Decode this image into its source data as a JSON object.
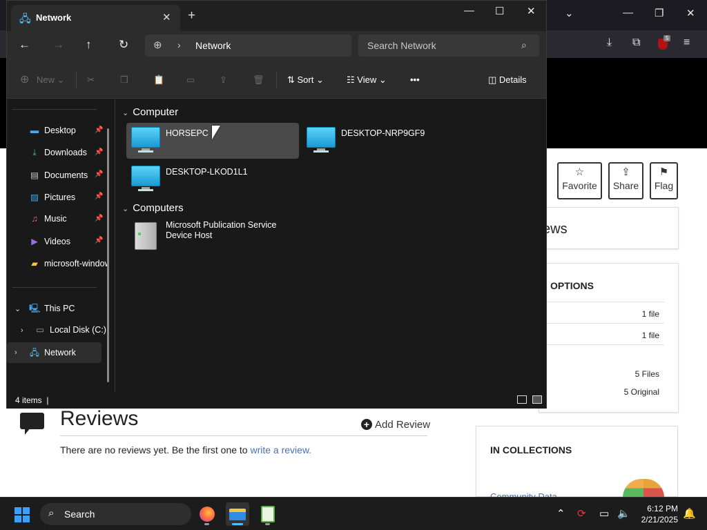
{
  "browser": {
    "window_controls": {
      "chevron": "⌄",
      "minimize": "—",
      "restore": "❐",
      "close": "✕"
    },
    "toolbar_icons": [
      "download-icon",
      "extensions-icon",
      "ublock-icon",
      "menu-icon"
    ],
    "ublock_badge": "5",
    "actions": {
      "favorite": "Favorite",
      "share": "Share",
      "flag": "Flag"
    },
    "reviews_partial_heading": "ews",
    "options_partial_heading": "OPTIONS",
    "options_rows": [
      "1 file",
      "1 file",
      "5 Files",
      "5 Original"
    ],
    "reviews": {
      "title": "Reviews",
      "add_review": "Add Review",
      "empty_text": "There are no reviews yet. Be the first one to ",
      "empty_link": "write a review."
    },
    "collections": {
      "heading": "IN COLLECTIONS",
      "partial_link": "Community Data"
    }
  },
  "explorer": {
    "tab_title": "Network",
    "new_tab": "+",
    "window_controls": {
      "minimize": "—",
      "maximize": "☐",
      "close": "✕"
    },
    "address": "Network",
    "search_placeholder": "Search Network",
    "commands": {
      "new": "New",
      "sort": "Sort",
      "view": "View",
      "more": "•••",
      "details": "Details"
    },
    "sidebar": {
      "quick_access": [
        {
          "label": "Desktop",
          "icon": "desktop-icon",
          "pinned": true
        },
        {
          "label": "Downloads",
          "icon": "downloads-icon",
          "pinned": true
        },
        {
          "label": "Documents",
          "icon": "documents-icon",
          "pinned": true
        },
        {
          "label": "Pictures",
          "icon": "pictures-icon",
          "pinned": true
        },
        {
          "label": "Music",
          "icon": "music-icon",
          "pinned": true
        },
        {
          "label": "Videos",
          "icon": "videos-icon",
          "pinned": true
        },
        {
          "label": "microsoft-windows",
          "icon": "folder-icon",
          "pinned": false
        }
      ],
      "this_pc": "This PC",
      "local_disk": "Local Disk (C:)",
      "network": "Network"
    },
    "groups": [
      {
        "name": "Computer",
        "items": [
          "HORSEPC",
          "DESKTOP-NRP9GF9",
          "DESKTOP-LKOD1L1"
        ]
      },
      {
        "name": "Computers",
        "items": [
          "Microsoft Publication Service Device Host"
        ]
      }
    ],
    "item_line1": "Microsoft Publication Service",
    "item_line2": "Device Host",
    "status": "4 items"
  },
  "taskbar": {
    "search": "Search",
    "apps": [
      "firefox-icon",
      "file-explorer-icon",
      "notepad-plus-plus-icon"
    ],
    "time": "6:12 PM",
    "date": "2/21/2025"
  }
}
